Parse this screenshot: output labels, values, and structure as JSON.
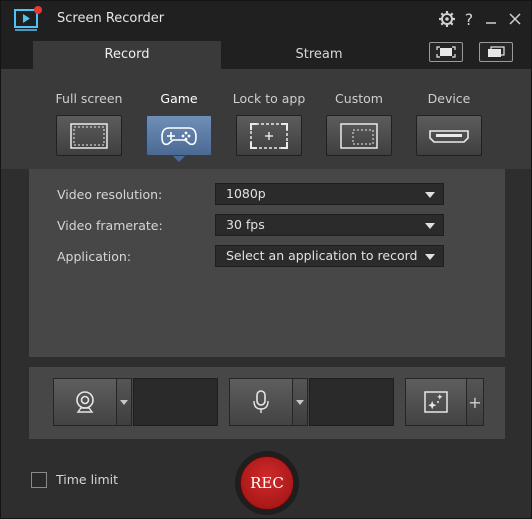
{
  "app": {
    "title": "Screen Recorder",
    "logo_icon": "screen-recorder-logo-icon",
    "colors": {
      "accent": "#5b7ea8",
      "record": "#c21f1f",
      "logo": "#4fc3f7"
    }
  },
  "titlebar": {
    "settings_icon": "gear-icon",
    "help_label": "?",
    "minimize_icon": "minimize-icon",
    "close_icon": "close-icon"
  },
  "tabs": [
    {
      "label": "Record",
      "active": true
    },
    {
      "label": "Stream",
      "active": false
    }
  ],
  "view_buttons": [
    "fullscreen-view-icon",
    "compact-view-icon"
  ],
  "modes": [
    {
      "label": "Full screen",
      "icon": "full-screen-icon",
      "active": false
    },
    {
      "label": "Game",
      "icon": "gamepad-icon",
      "active": true
    },
    {
      "label": "Lock to app",
      "icon": "lock-to-app-icon",
      "active": false
    },
    {
      "label": "Custom",
      "icon": "custom-region-icon",
      "active": false
    },
    {
      "label": "Device",
      "icon": "hdmi-device-icon",
      "active": false
    }
  ],
  "settings": {
    "resolution": {
      "label": "Video resolution:",
      "value": "1080p"
    },
    "framerate": {
      "label": "Video framerate:",
      "value": "30 fps"
    },
    "application": {
      "label": "Application:",
      "value": "Select an application to record"
    }
  },
  "devices": {
    "webcam_icon": "webcam-icon",
    "microphone_icon": "microphone-icon",
    "effects_icon": "effects-sparkle-icon",
    "add_label": "+"
  },
  "footer": {
    "time_limit_label": "Time limit",
    "time_limit_checked": false,
    "rec_label": "REC"
  }
}
